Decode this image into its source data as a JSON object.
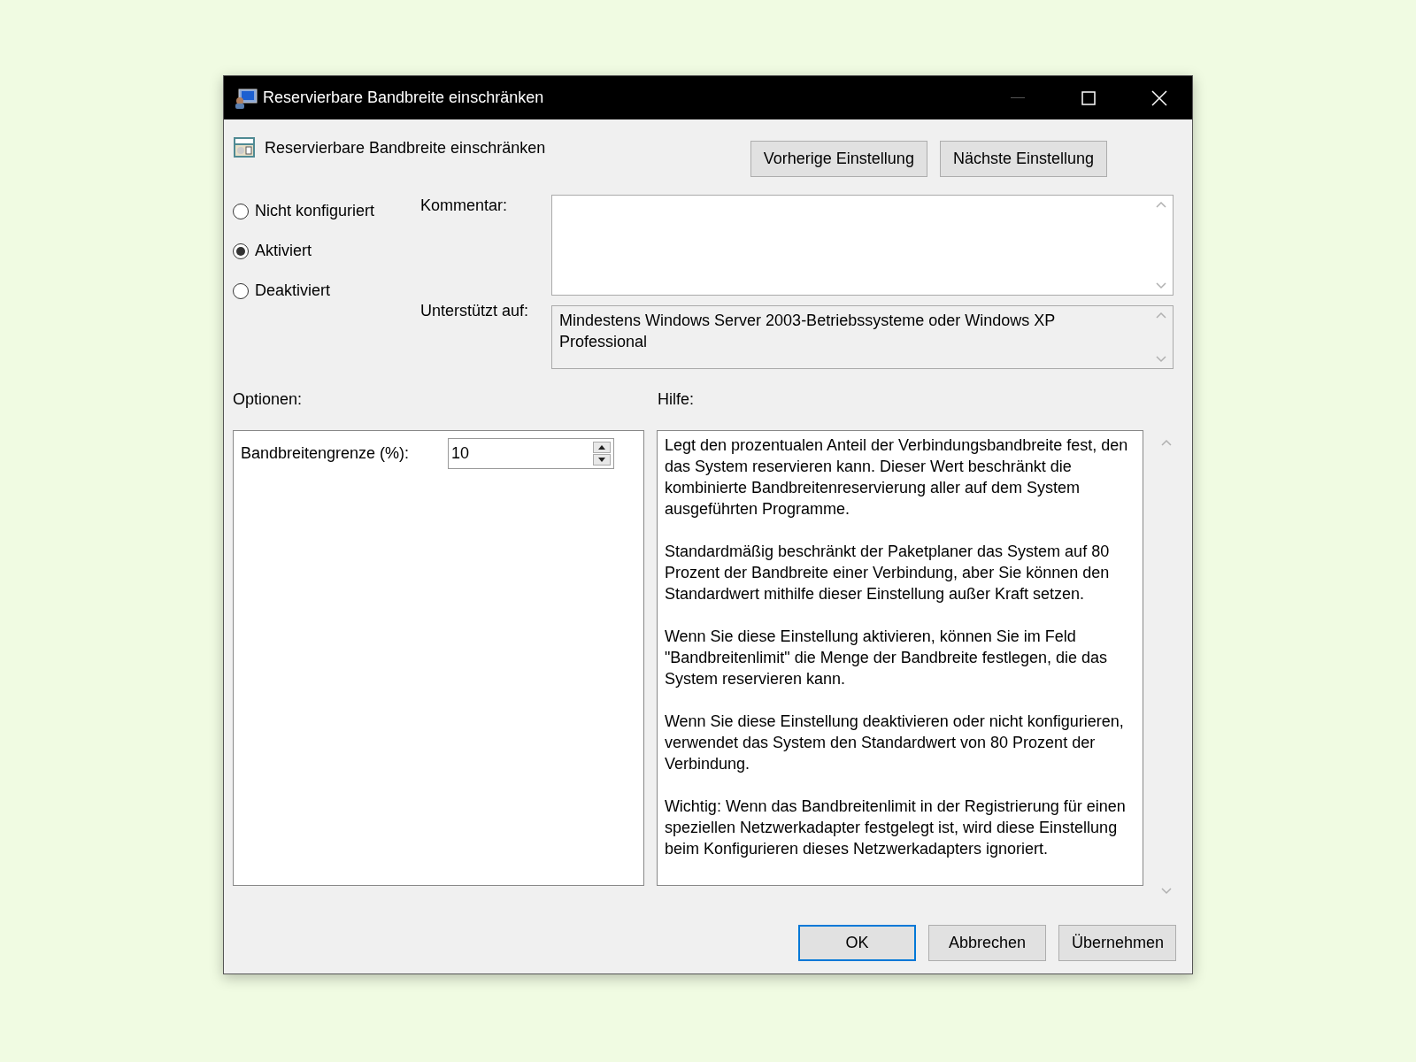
{
  "window": {
    "title": "Reservierbare Bandbreite einschränken"
  },
  "header": {
    "title": "Reservierbare Bandbreite einschränken",
    "buttons": [
      "Vorherige Einstellung",
      "Nächste Einstellung"
    ]
  },
  "states": [
    {
      "label": "Nicht konfiguriert",
      "selected": false
    },
    {
      "label": "Aktiviert",
      "selected": true
    },
    {
      "label": "Deaktiviert",
      "selected": false
    }
  ],
  "comment": {
    "label": "Kommentar:"
  },
  "supported": {
    "label": "Unterstützt auf:",
    "text": "Mindestens Windows Server 2003-Betriebssysteme oder Windows XP Professional"
  },
  "options": {
    "label": "Optionen:",
    "fields": [
      {
        "label": "Bandbreitengrenze (%):",
        "value": "10"
      }
    ]
  },
  "help": {
    "label": "Hilfe:",
    "paragraphs": [
      "Legt den prozentualen Anteil der Verbindungsbandbreite fest, den das System reservieren kann. Dieser Wert beschränkt die kombinierte Bandbreitenreservierung aller auf dem System ausgeführten Programme.",
      "Standardmäßig beschränkt der Paketplaner das System auf 80 Prozent der Bandbreite einer Verbindung, aber Sie können den Standardwert mithilfe dieser Einstellung außer Kraft setzen.",
      "Wenn Sie diese Einstellung aktivieren, können Sie im Feld \"Bandbreitenlimit\" die Menge der Bandbreite festlegen, die das System reservieren kann.",
      "Wenn Sie diese Einstellung deaktivieren oder nicht konfigurieren, verwendet das System den Standardwert von 80 Prozent der Verbindung.",
      "Wichtig: Wenn das Bandbreitenlimit in der Registrierung für einen speziellen Netzwerkadapter festgelegt ist, wird diese Einstellung beim Konfigurieren dieses Netzwerkadapters ignoriert."
    ]
  },
  "buttons": [
    {
      "label": "OK",
      "default": true
    },
    {
      "label": "Abbrechen",
      "default": false
    },
    {
      "label": "Übernehmen",
      "default": false
    }
  ]
}
